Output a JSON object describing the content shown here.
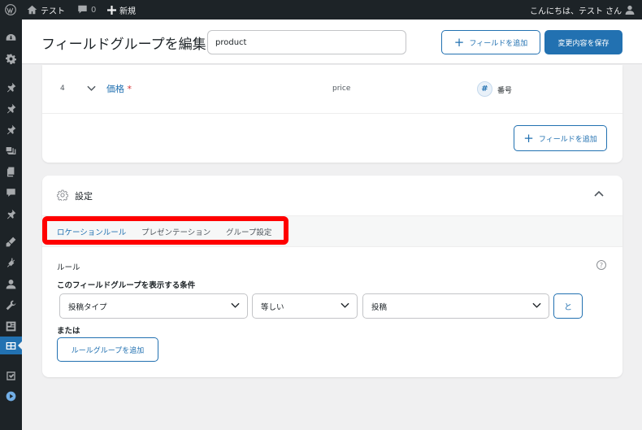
{
  "admin_bar": {
    "site_name": "テスト",
    "comments_count": "0",
    "new_label": "新規",
    "greeting": "こんにちは、テスト さん"
  },
  "header": {
    "title": "フィールドグループを編集",
    "title_input_value": "product",
    "add_field_label": "フィールドを追加",
    "save_label": "変更内容を保存"
  },
  "fields": {
    "rows": [
      {
        "order": "4",
        "label": "価格",
        "required_mark": "*",
        "name": "price",
        "type": "番号",
        "type_icon": "#"
      }
    ],
    "add_field_label": "フィールドを追加"
  },
  "settings": {
    "title": "設定",
    "tabs": [
      {
        "label": "ロケーションルール",
        "active": true
      },
      {
        "label": "プレゼンテーション",
        "active": false
      },
      {
        "label": "グループ設定",
        "active": false
      }
    ],
    "rules_label": "ルール",
    "help_glyph": "?",
    "condition_label": "このフィールドグループを表示する条件",
    "rule": {
      "param": "投稿タイプ",
      "operator": "等しい",
      "value": "投稿"
    },
    "and_label": "と",
    "or_label": "または",
    "add_rule_group_label": "ルールグループを追加"
  },
  "colors": {
    "accent": "#2271b1",
    "highlight": "#ff0000",
    "admin_bg": "#1d2327",
    "required": "#d63638"
  },
  "sidebar_icons": [
    "dashboard-icon",
    "gear-icon",
    "pin-icon",
    "pin-icon",
    "pin-icon",
    "media-icon",
    "pages-icon",
    "comments-icon",
    "pin-icon",
    "appearance-icon",
    "plugins-icon",
    "users-icon",
    "tools-icon",
    "settings-icon",
    "custom-fields-icon",
    "check-icon",
    "play-icon"
  ]
}
